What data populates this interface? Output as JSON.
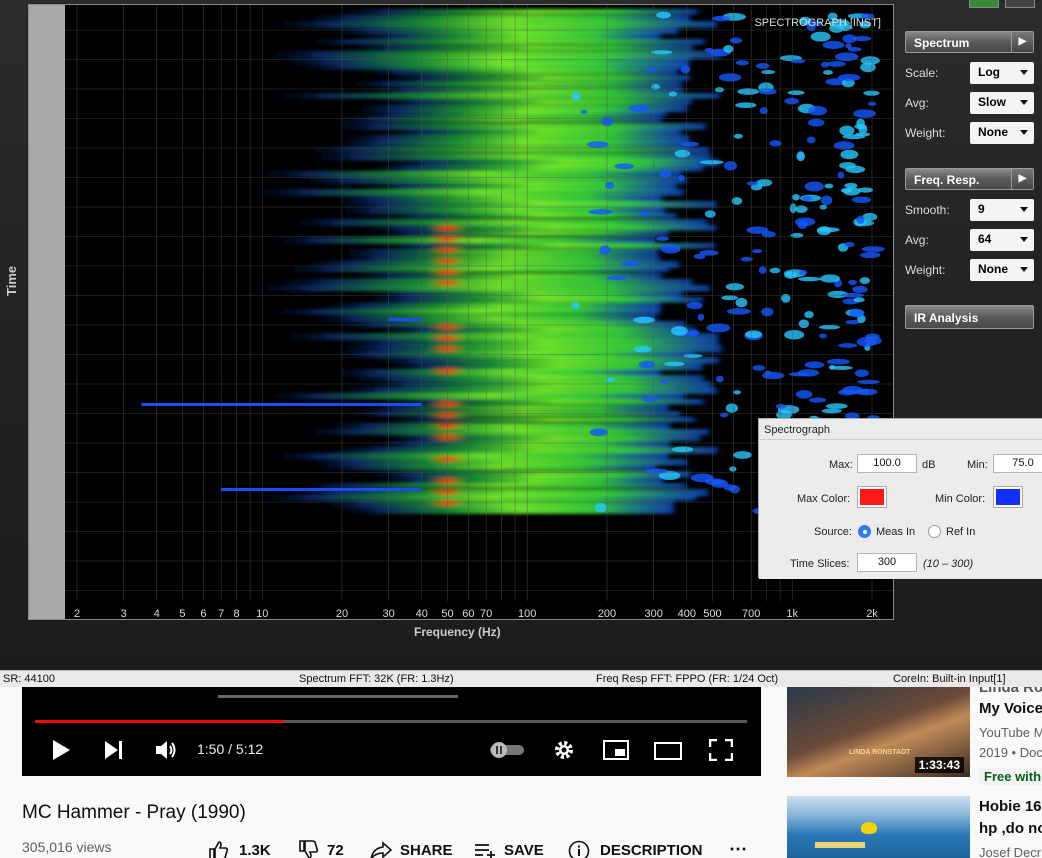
{
  "plot": {
    "title": "SPECTROGRAPH [INST]",
    "x_label": "Frequency (Hz)",
    "y_label": "Time",
    "x_ticks": [
      "2",
      "3",
      "4",
      "5",
      "6",
      "7",
      "8",
      "10",
      "20",
      "30",
      "40",
      "50",
      "60",
      "70",
      "100",
      "200",
      "300",
      "400",
      "500",
      "700",
      "1k",
      "2k"
    ]
  },
  "panel": {
    "spectrum": {
      "header": "Spectrum",
      "scale_label": "Scale:",
      "scale_value": "Log",
      "avg_label": "Avg:",
      "avg_value": "Slow",
      "weight_label": "Weight:",
      "weight_value": "None"
    },
    "freq_resp": {
      "header": "Freq. Resp.",
      "smooth_label": "Smooth:",
      "smooth_value": "9",
      "avg_label": "Avg:",
      "avg_value": "64",
      "weight_label": "Weight:",
      "weight_value": "None"
    },
    "ir_analysis": {
      "header": "IR Analysis"
    }
  },
  "popup": {
    "title": "Spectrograph",
    "max_label": "Max:",
    "max_value": "100.0",
    "db_unit": "dB",
    "min_label": "Min:",
    "min_value": "75.0",
    "max_color_label": "Max Color:",
    "max_color": "#ff1a1a",
    "min_color_label": "Min Color:",
    "min_color": "#1030ff",
    "source_label": "Source:",
    "source_opt1": "Meas In",
    "source_opt2": "Ref In",
    "time_slices_label": "Time Slices:",
    "time_slices_value": "300",
    "time_slices_range": "(10 – 300)"
  },
  "status_bar": {
    "sr": "SR: 44100",
    "spectrum_fft": "Spectrum FFT: 32K (FR: 1.3Hz)",
    "freq_resp_fft": "Freq Resp FFT: FPPO (FR: 1/24 Oct)",
    "core_in": "CoreIn: Built-in Input[1]"
  },
  "youtube": {
    "time": "1:50 / 5:12",
    "progress": 0.35,
    "title": "MC Hammer - Pray (1990)",
    "views": "305,016 views",
    "likes": "1.3K",
    "dislikes": "72",
    "share": "SHARE",
    "save": "SAVE",
    "description": "DESCRIPTION",
    "more": "⋯",
    "reco": [
      {
        "title_line1": "Linda Ro",
        "title_line2": "My Voice",
        "channel": "YouTube M",
        "meta": "2019 • Doc",
        "badge": "Free with",
        "duration": "1:33:43",
        "thumb_caption": "LINDA RONSTADT"
      },
      {
        "title_line1": "Hobie 16",
        "title_line2": "hp ,do no",
        "channel": "Josef Decr"
      }
    ]
  },
  "colors": {
    "accent_red": "#ff0000",
    "panel_bg": "#2b2b2b"
  }
}
